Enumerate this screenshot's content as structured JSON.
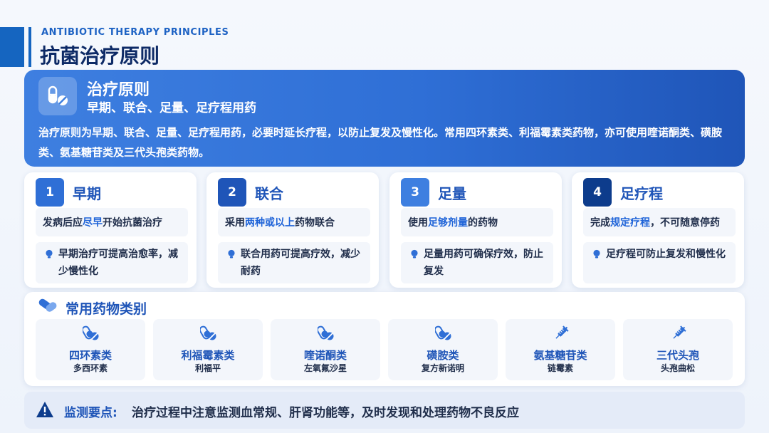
{
  "header": {
    "subtitle_en": "ANTIBIOTIC THERAPY PRINCIPLES",
    "title": "抗菌治疗原则"
  },
  "hero": {
    "icon": "pills-icon",
    "title": "治疗原则",
    "subtitle": "早期、联合、足量、足疗程用药",
    "description": "治疗原则为早期、联合、足量、足疗程用药，必要时延长疗程，以防止复发及慢性化。常用四环素类、利福霉素类药物，亦可使用喹诺酮类、磺胺类、氨基糖苷类及三代头孢类药物。"
  },
  "steps": [
    {
      "num": "1",
      "title": "早期",
      "desc_pre": "发病后应",
      "desc_hl": "尽早",
      "desc_post": "开始抗菌治疗",
      "tip": "早期治疗可提高治愈率，减少慢性化",
      "color": "#2f6fd6"
    },
    {
      "num": "2",
      "title": "联合",
      "desc_pre": "采用",
      "desc_hl": "两种或以上",
      "desc_post": "药物联合",
      "tip": "联合用药可提高疗效，减少耐药",
      "color": "#1f55b8"
    },
    {
      "num": "3",
      "title": "足量",
      "desc_pre": "使用",
      "desc_hl": "足够剂量",
      "desc_post": "的药物",
      "tip": "足量用药可确保疗效，防止复发",
      "color": "#3e7fe0"
    },
    {
      "num": "4",
      "title": "足疗程",
      "desc_pre": "完成",
      "desc_hl": "规定疗程",
      "desc_post": "，不可随意停药",
      "tip": "足疗程可防止复发和慢性化",
      "color": "#0d3c8c"
    }
  ],
  "drugs": {
    "title": "常用药物类别",
    "items": [
      {
        "name": "四环素类",
        "example": "多西环素",
        "icon": "pills-icon"
      },
      {
        "name": "利福霉素类",
        "example": "利福平",
        "icon": "pills-icon"
      },
      {
        "name": "喹诺酮类",
        "example": "左氧氟沙星",
        "icon": "pills-icon"
      },
      {
        "name": "磺胺类",
        "example": "复方新诺明",
        "icon": "pills-icon"
      },
      {
        "name": "氨基糖苷类",
        "example": "链霉素",
        "icon": "syringe-icon"
      },
      {
        "name": "三代头孢",
        "example": "头孢曲松",
        "icon": "syringe-icon"
      }
    ]
  },
  "monitor": {
    "icon": "warning-icon",
    "label": "监测要点:",
    "text": "治疗过程中注意监测血常规、肝肾功能等，及时发现和处理药物不良反应"
  },
  "colors": {
    "primary": "#1f55b8",
    "accent": "#1e63d8",
    "dark": "#0d2a66"
  }
}
